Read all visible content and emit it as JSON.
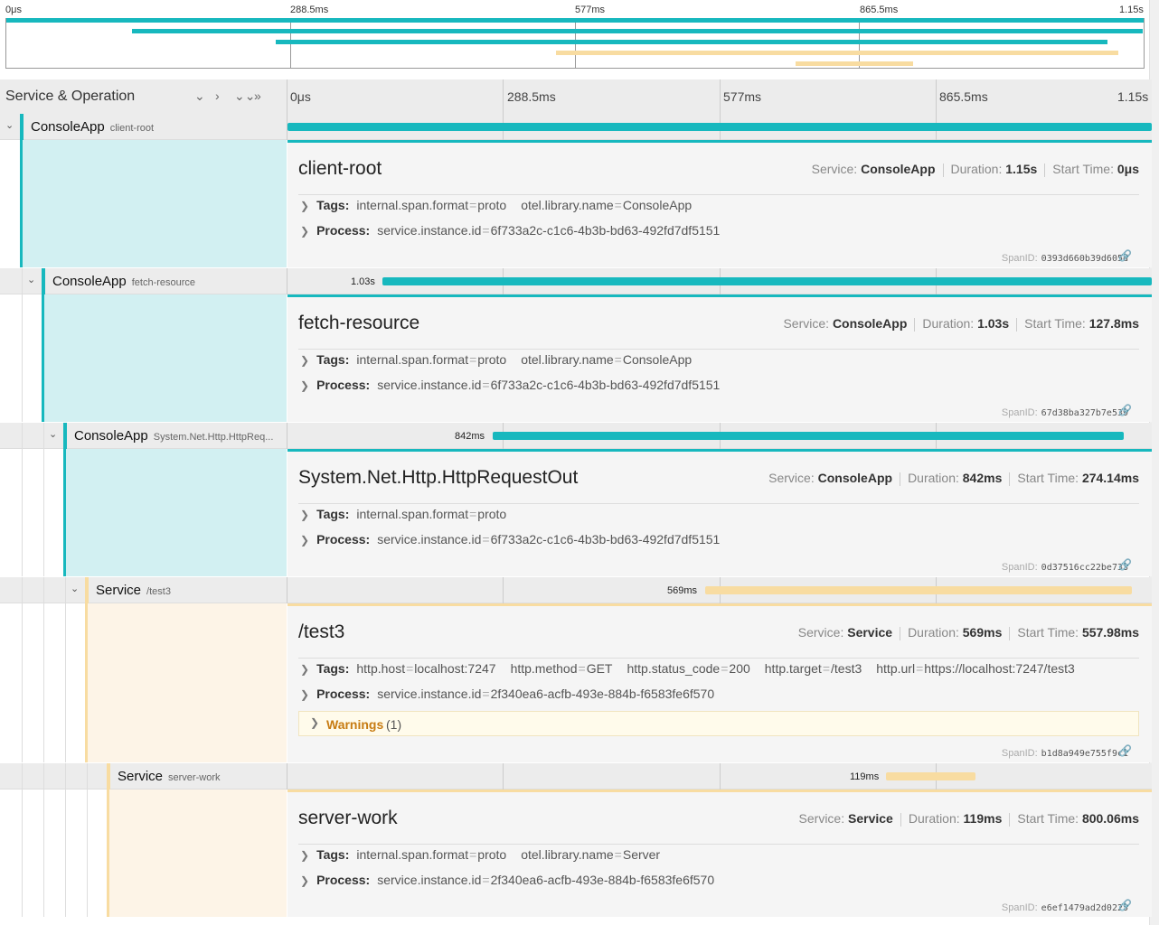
{
  "minimap": {
    "ticks": [
      "0μs",
      "288.5ms",
      "577ms",
      "865.5ms",
      "1.15s"
    ]
  },
  "header": {
    "title": "Service & Operation",
    "ticks": [
      "0μs",
      "288.5ms",
      "577ms",
      "865.5ms",
      "1.15s"
    ]
  },
  "colors": {
    "consoleapp": "#17b8be",
    "consoleapp_light": "#d2f0f2",
    "service": "#f8dca1",
    "service_light": "#fdf4e7"
  },
  "spans": [
    {
      "service": "ConsoleApp",
      "operation": "client-root",
      "duration_label": "",
      "title": "client-root",
      "meta": {
        "service_label": "Service:",
        "service": "ConsoleApp",
        "duration_label": "Duration:",
        "duration": "1.15s",
        "start_label": "Start Time:",
        "start": "0μs"
      },
      "tags_label": "Tags:",
      "tags": [
        {
          "k": "internal.span.format",
          "v": "proto"
        },
        {
          "k": "otel.library.name",
          "v": "ConsoleApp"
        }
      ],
      "process_label": "Process:",
      "process": [
        {
          "k": "service.instance.id",
          "v": "6f733a2c-c1c6-4b3b-bd63-492fd7df5151"
        }
      ],
      "spanid_label": "SpanID:",
      "spanid": "0393d660b39d605d"
    },
    {
      "service": "ConsoleApp",
      "operation": "fetch-resource",
      "duration_label": "1.03s",
      "title": "fetch-resource",
      "meta": {
        "service_label": "Service:",
        "service": "ConsoleApp",
        "duration_label": "Duration:",
        "duration": "1.03s",
        "start_label": "Start Time:",
        "start": "127.8ms"
      },
      "tags_label": "Tags:",
      "tags": [
        {
          "k": "internal.span.format",
          "v": "proto"
        },
        {
          "k": "otel.library.name",
          "v": "ConsoleApp"
        }
      ],
      "process_label": "Process:",
      "process": [
        {
          "k": "service.instance.id",
          "v": "6f733a2c-c1c6-4b3b-bd63-492fd7df5151"
        }
      ],
      "spanid_label": "SpanID:",
      "spanid": "67d38ba327b7e539"
    },
    {
      "service": "ConsoleApp",
      "operation": "System.Net.Http.HttpReq...",
      "duration_label": "842ms",
      "title": "System.Net.Http.HttpRequestOut",
      "meta": {
        "service_label": "Service:",
        "service": "ConsoleApp",
        "duration_label": "Duration:",
        "duration": "842ms",
        "start_label": "Start Time:",
        "start": "274.14ms"
      },
      "tags_label": "Tags:",
      "tags": [
        {
          "k": "internal.span.format",
          "v": "proto"
        }
      ],
      "process_label": "Process:",
      "process": [
        {
          "k": "service.instance.id",
          "v": "6f733a2c-c1c6-4b3b-bd63-492fd7df5151"
        }
      ],
      "spanid_label": "SpanID:",
      "spanid": "0d37516cc22be733"
    },
    {
      "service": "Service",
      "operation": "/test3",
      "duration_label": "569ms",
      "title": "/test3",
      "meta": {
        "service_label": "Service:",
        "service": "Service",
        "duration_label": "Duration:",
        "duration": "569ms",
        "start_label": "Start Time:",
        "start": "557.98ms"
      },
      "tags_label": "Tags:",
      "tags": [
        {
          "k": "http.host",
          "v": "localhost:7247"
        },
        {
          "k": "http.method",
          "v": "GET"
        },
        {
          "k": "http.status_code",
          "v": "200"
        },
        {
          "k": "http.target",
          "v": "/test3"
        },
        {
          "k": "http.url",
          "v": "https://localhost:7247/test3"
        }
      ],
      "process_label": "Process:",
      "process": [
        {
          "k": "service.instance.id",
          "v": "2f340ea6-acfb-493e-884b-f6583fe6f570"
        }
      ],
      "warnings_label": "Warnings",
      "warnings_count": "(1)",
      "spanid_label": "SpanID:",
      "spanid": "b1d8a949e755f9c1"
    },
    {
      "service": "Service",
      "operation": "server-work",
      "duration_label": "119ms",
      "title": "server-work",
      "meta": {
        "service_label": "Service:",
        "service": "Service",
        "duration_label": "Duration:",
        "duration": "119ms",
        "start_label": "Start Time:",
        "start": "800.06ms"
      },
      "tags_label": "Tags:",
      "tags": [
        {
          "k": "internal.span.format",
          "v": "proto"
        },
        {
          "k": "otel.library.name",
          "v": "Server"
        }
      ],
      "process_label": "Process:",
      "process": [
        {
          "k": "service.instance.id",
          "v": "2f340ea6-acfb-493e-884b-f6583fe6f570"
        }
      ],
      "spanid_label": "SpanID:",
      "spanid": "e6ef1479ad2d0225"
    }
  ]
}
